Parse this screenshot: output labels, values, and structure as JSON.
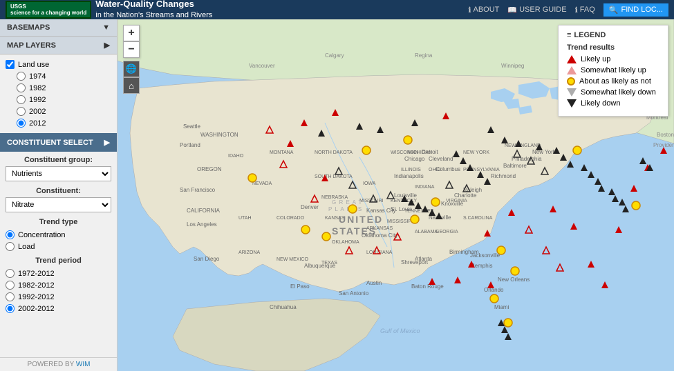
{
  "header": {
    "logo_text": "USGS",
    "logo_sub": "science for a changing world",
    "title": "Water-Quality Changes",
    "subtitle": "in the Nation's Streams and Rivers",
    "nav": {
      "about": "ABOUT",
      "user_guide": "USER GUIDE",
      "faq": "FAQ",
      "find_loc": "FIND LOC..."
    }
  },
  "sidebar": {
    "basemaps_label": "BASEMAPS",
    "map_layers_label": "MAP LAYERS",
    "land_use_label": "Land use",
    "land_use_checked": true,
    "years": [
      "1974",
      "1982",
      "1992",
      "2002",
      "2012"
    ],
    "selected_year": "2012",
    "constituent_select_label": "CONSTITUENT SELECT",
    "constituent_group_label": "Constituent group:",
    "constituent_group_value": "Nutrients",
    "constituent_label": "Constituent:",
    "constituent_value": "Nitrate",
    "trend_type_label": "Trend type",
    "trend_types": [
      {
        "label": "Concentration",
        "selected": true
      },
      {
        "label": "Load",
        "selected": false
      }
    ],
    "trend_period_label": "Trend period",
    "trend_periods": [
      {
        "label": "1972-2012",
        "selected": false
      },
      {
        "label": "1982-2012",
        "selected": false
      },
      {
        "label": "1992-2012",
        "selected": false
      },
      {
        "label": "2002-2012",
        "selected": true
      }
    ],
    "powered_by_label": "POWERED BY",
    "powered_by_link": "WIM"
  },
  "map": {
    "zoom_in": "+",
    "zoom_out": "−"
  },
  "legend": {
    "header_icon": "≡",
    "header_label": "LEGEND",
    "title": "Trend results",
    "items": [
      {
        "shape": "tri-up-red",
        "label": "Likely up"
      },
      {
        "shape": "tri-up-outline-red",
        "label": "Somewhat likely up"
      },
      {
        "shape": "circle-yellow",
        "label": "About as likely as not"
      },
      {
        "shape": "tri-down-outline",
        "label": "Somewhat likely down"
      },
      {
        "shape": "tri-down-black",
        "label": "Likely down"
      }
    ]
  }
}
